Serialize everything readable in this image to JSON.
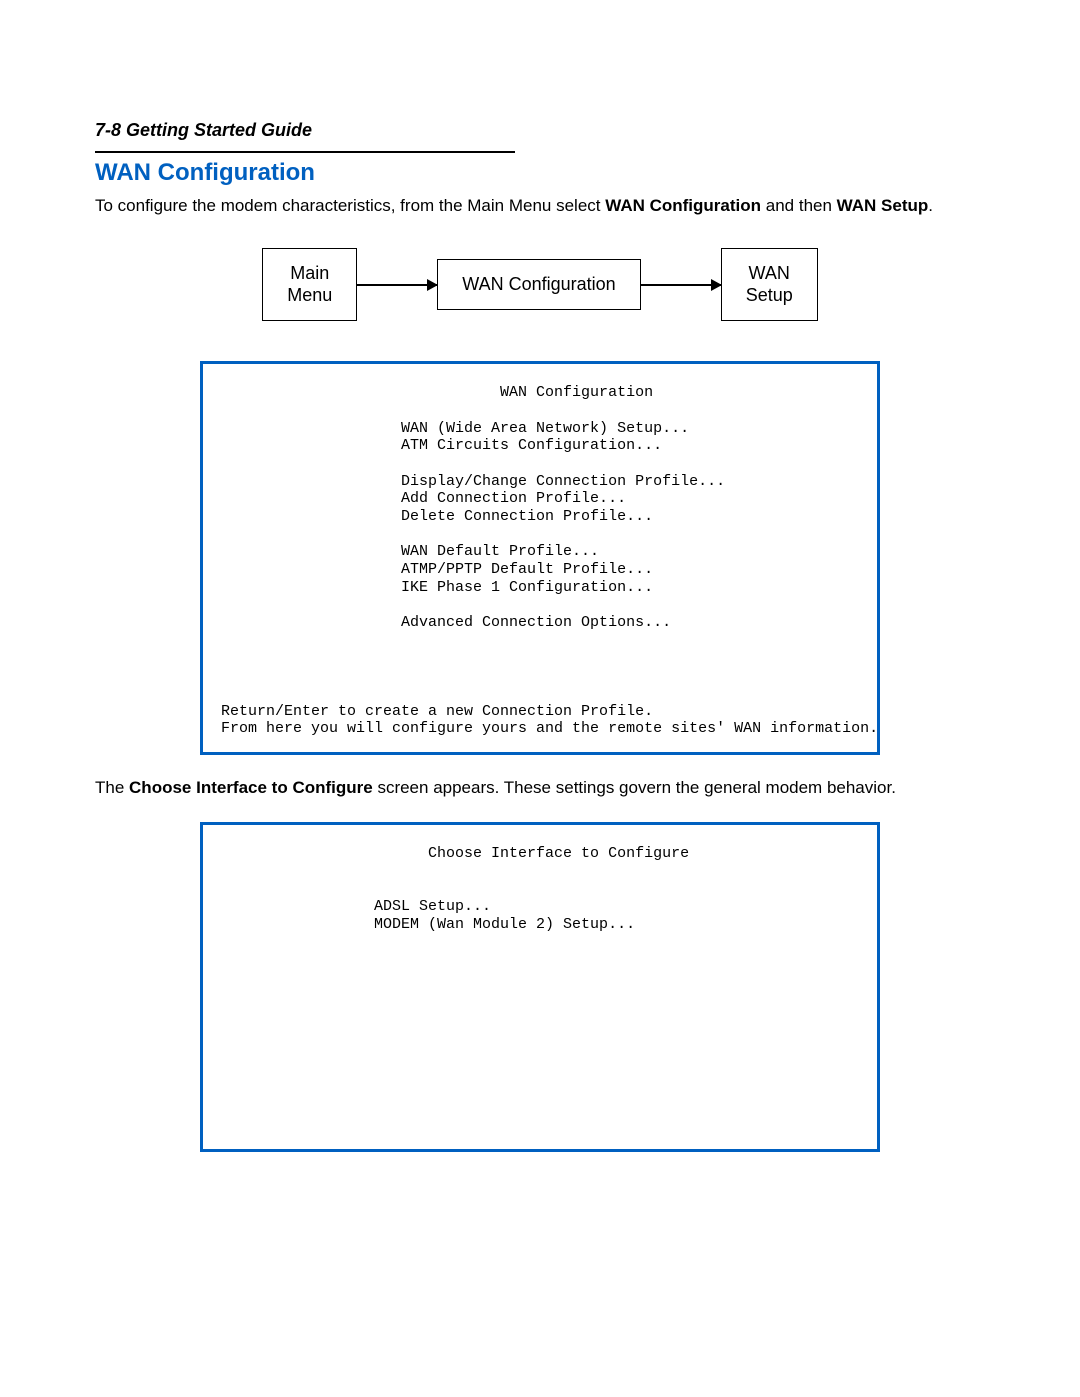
{
  "header": {
    "line": "7-8  Getting Started Guide"
  },
  "section": {
    "title": "WAN Configuration"
  },
  "intro": {
    "pre": "To configure the modem characteristics, from the Main Menu select ",
    "b1": "WAN Configuration",
    "mid": " and then ",
    "b2": "WAN Setup",
    "post": "."
  },
  "flow": {
    "box1a": "Main",
    "box1b": "Menu",
    "box2": "WAN Configuration",
    "box3a": "WAN",
    "box3b": "Setup"
  },
  "term1": {
    "title": "                               WAN Configuration",
    "l1": "                    WAN (Wide Area Network) Setup...",
    "l2": "                    ATM Circuits Configuration...",
    "l3": "                    Display/Change Connection Profile...",
    "l4": "                    Add Connection Profile...",
    "l5": "                    Delete Connection Profile...",
    "l6": "                    WAN Default Profile...",
    "l7": "                    ATMP/PPTP Default Profile...",
    "l8": "                    IKE Phase 1 Configuration...",
    "l9": "                    Advanced Connection Options...",
    "f1": "Return/Enter to create a new Connection Profile.",
    "f2": "From here you will configure yours and the remote sites' WAN information."
  },
  "mid": {
    "pre": "The ",
    "b": "Choose Interface to Configure",
    "post": " screen appears. These settings govern the general modem behavior."
  },
  "term2": {
    "title": "                       Choose Interface to Configure",
    "l1": "                 ADSL Setup...",
    "l2": "                 MODEM (Wan Module 2) Setup..."
  }
}
